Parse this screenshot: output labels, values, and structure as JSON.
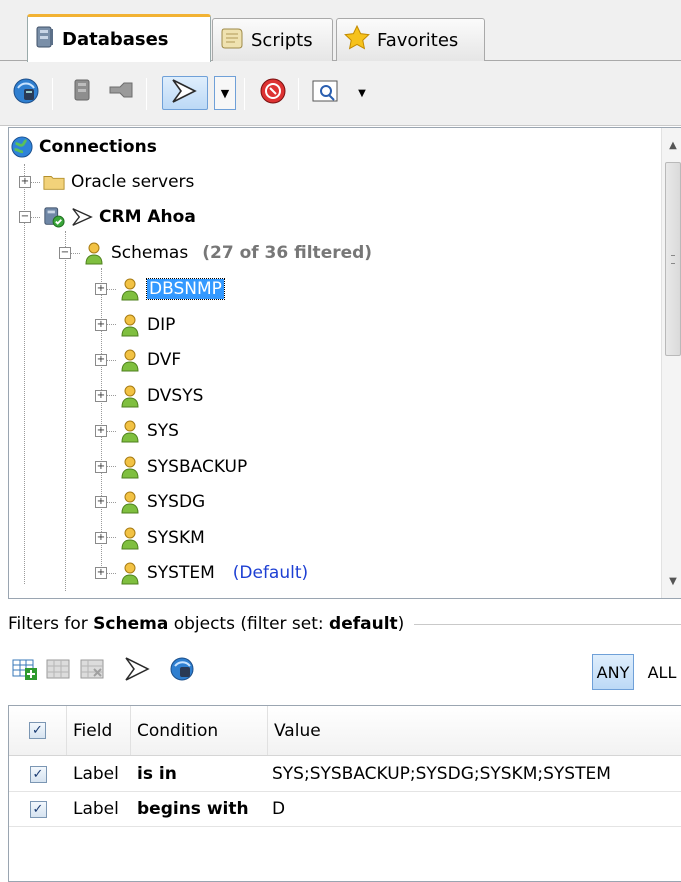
{
  "tabs": [
    {
      "label": "Databases",
      "icon": "database-icon",
      "active": true
    },
    {
      "label": "Scripts",
      "icon": "scroll-icon",
      "active": false
    },
    {
      "label": "Favorites",
      "icon": "star-icon",
      "active": false
    }
  ],
  "toolbar": {
    "buttons": [
      "connect-db-icon",
      "disconnect-icon",
      "refresh-icon",
      "filter-icon",
      "filter-dropdown",
      "stop-icon",
      "search-icon",
      "search-dropdown"
    ]
  },
  "tree": {
    "root": {
      "label": "Connections"
    },
    "oracle": {
      "label": "Oracle servers"
    },
    "connection": {
      "label": "CRM Ahoa"
    },
    "schemas": {
      "label": "Schemas",
      "note": "(27 of 36 filtered)"
    },
    "items": [
      {
        "label": "DBSNMP",
        "selected": true,
        "note": ""
      },
      {
        "label": "DIP",
        "note": ""
      },
      {
        "label": "DVF",
        "note": ""
      },
      {
        "label": "DVSYS",
        "note": ""
      },
      {
        "label": "SYS",
        "note": ""
      },
      {
        "label": "SYSBACKUP",
        "note": ""
      },
      {
        "label": "SYSDG",
        "note": ""
      },
      {
        "label": "SYSKM",
        "note": ""
      },
      {
        "label": "SYSTEM",
        "note": "(Default)"
      }
    ]
  },
  "filters": {
    "prefix": "Filters for ",
    "object": "Schema",
    "middle": " objects (filter set: ",
    "set": "default",
    "suffix": ")",
    "any": "ANY",
    "all": "ALL",
    "columns": {
      "field": "Field",
      "condition": "Condition",
      "value": "Value"
    },
    "rows": [
      {
        "field": "Label",
        "condition": "is in",
        "value": "SYS;SYSBACKUP;SYSDG;SYSKM;SYSTEM",
        "checked": true
      },
      {
        "field": "Label",
        "condition": "begins with",
        "value": "D",
        "checked": true
      }
    ]
  },
  "colors": {
    "accent": "#3399ff",
    "tab_highlight": "#f2b233",
    "default_note": "#1d3fd3"
  }
}
